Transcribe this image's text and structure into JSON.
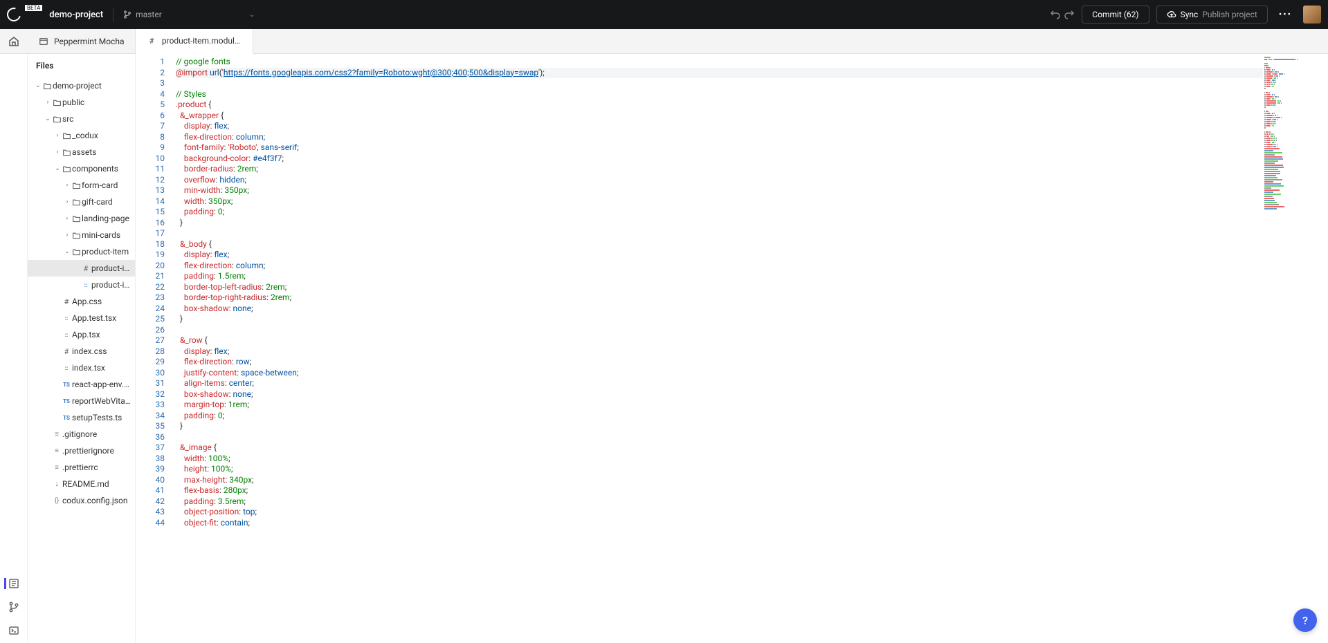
{
  "top": {
    "beta": "BETA",
    "project": "demo-project",
    "branch": "master",
    "commit": "Commit (62)",
    "sync": "Sync",
    "publish": "Publish project"
  },
  "tabs": [
    {
      "icon": "board",
      "label": "Peppermint Mocha",
      "active": false
    },
    {
      "icon": "hash",
      "label": "product-item.module...",
      "active": true
    }
  ],
  "sidebar": {
    "heading": "Files",
    "tree": [
      {
        "d": 0,
        "c": "open",
        "i": "folder",
        "t": "demo-project"
      },
      {
        "d": 1,
        "c": "closed",
        "i": "folder",
        "t": "public"
      },
      {
        "d": 1,
        "c": "open",
        "i": "folder",
        "t": "src"
      },
      {
        "d": 2,
        "c": "closed",
        "i": "folder",
        "t": "_codux"
      },
      {
        "d": 2,
        "c": "closed",
        "i": "folder",
        "t": "assets"
      },
      {
        "d": 2,
        "c": "open",
        "i": "folder",
        "t": "components"
      },
      {
        "d": 3,
        "c": "closed",
        "i": "folder",
        "t": "form-card"
      },
      {
        "d": 3,
        "c": "closed",
        "i": "folder",
        "t": "gift-card"
      },
      {
        "d": 3,
        "c": "closed",
        "i": "folder",
        "t": "landing-page"
      },
      {
        "d": 3,
        "c": "closed",
        "i": "folder",
        "t": "mini-cards"
      },
      {
        "d": 3,
        "c": "open",
        "i": "folder",
        "t": "product-item"
      },
      {
        "d": 4,
        "c": "none",
        "i": "hash",
        "t": "product-ite...",
        "sel": true
      },
      {
        "d": 4,
        "c": "none",
        "i": "tsx",
        "t": "product-ite..."
      },
      {
        "d": 2,
        "c": "none",
        "i": "hash",
        "t": "App.css"
      },
      {
        "d": 2,
        "c": "none",
        "i": "tsx",
        "t": "App.test.tsx"
      },
      {
        "d": 2,
        "c": "none",
        "i": "tsx",
        "t": "App.tsx"
      },
      {
        "d": 2,
        "c": "none",
        "i": "hash",
        "t": "index.css"
      },
      {
        "d": 2,
        "c": "none",
        "i": "tsx",
        "t": "index.tsx"
      },
      {
        "d": 2,
        "c": "none",
        "i": "ts",
        "t": "react-app-env.d.ts"
      },
      {
        "d": 2,
        "c": "none",
        "i": "ts",
        "t": "reportWebVital..."
      },
      {
        "d": 2,
        "c": "none",
        "i": "ts",
        "t": "setupTests.ts"
      },
      {
        "d": 1,
        "c": "none",
        "i": "file",
        "t": ".gitignore"
      },
      {
        "d": 1,
        "c": "none",
        "i": "file",
        "t": ".prettierignore"
      },
      {
        "d": 1,
        "c": "none",
        "i": "file",
        "t": ".prettierrc"
      },
      {
        "d": 1,
        "c": "none",
        "i": "md",
        "t": "README.md"
      },
      {
        "d": 1,
        "c": "none",
        "i": "json",
        "t": "codux.config.json"
      }
    ]
  },
  "editor": {
    "highlight_line": 2,
    "lines": [
      [
        [
          "cm",
          "// google fonts"
        ]
      ],
      [
        [
          "kw",
          "@import"
        ],
        [
          "punc",
          " "
        ],
        [
          "fn",
          "url"
        ],
        [
          "punc",
          "("
        ],
        [
          "str",
          "'"
        ],
        [
          "url",
          "https://fonts.googleapis.com/css2?family=Roboto:wght@300;400;500&display=swap"
        ],
        [
          "str",
          "'"
        ],
        [
          "punc",
          ");"
        ]
      ],
      [],
      [
        [
          "cm",
          "// Styles"
        ]
      ],
      [
        [
          "sel",
          ".product"
        ],
        [
          "punc",
          " {"
        ]
      ],
      [
        [
          "punc",
          "  "
        ],
        [
          "sel",
          "&_wrapper"
        ],
        [
          "punc",
          " {"
        ]
      ],
      [
        [
          "punc",
          "    "
        ],
        [
          "prop",
          "display"
        ],
        [
          "punc",
          ": "
        ],
        [
          "val",
          "flex"
        ],
        [
          "punc",
          ";"
        ]
      ],
      [
        [
          "punc",
          "    "
        ],
        [
          "prop",
          "flex-direction"
        ],
        [
          "punc",
          ": "
        ],
        [
          "val",
          "column"
        ],
        [
          "punc",
          ";"
        ]
      ],
      [
        [
          "punc",
          "    "
        ],
        [
          "prop",
          "font-family"
        ],
        [
          "punc",
          ": "
        ],
        [
          "str",
          "'Roboto'"
        ],
        [
          "punc",
          ", "
        ],
        [
          "val",
          "sans-serif"
        ],
        [
          "punc",
          ";"
        ]
      ],
      [
        [
          "punc",
          "    "
        ],
        [
          "prop",
          "background-color"
        ],
        [
          "punc",
          ": "
        ],
        [
          "val",
          "#e4f3f7"
        ],
        [
          "punc",
          ";"
        ]
      ],
      [
        [
          "punc",
          "    "
        ],
        [
          "prop",
          "border-radius"
        ],
        [
          "punc",
          ": "
        ],
        [
          "num",
          "2rem"
        ],
        [
          "punc",
          ";"
        ]
      ],
      [
        [
          "punc",
          "    "
        ],
        [
          "prop",
          "overflow"
        ],
        [
          "punc",
          ": "
        ],
        [
          "val",
          "hidden"
        ],
        [
          "punc",
          ";"
        ]
      ],
      [
        [
          "punc",
          "    "
        ],
        [
          "prop",
          "min-width"
        ],
        [
          "punc",
          ": "
        ],
        [
          "num",
          "350px"
        ],
        [
          "punc",
          ";"
        ]
      ],
      [
        [
          "punc",
          "    "
        ],
        [
          "prop",
          "width"
        ],
        [
          "punc",
          ": "
        ],
        [
          "num",
          "350px"
        ],
        [
          "punc",
          ";"
        ]
      ],
      [
        [
          "punc",
          "    "
        ],
        [
          "prop",
          "padding"
        ],
        [
          "punc",
          ": "
        ],
        [
          "num",
          "0"
        ],
        [
          "punc",
          ";"
        ]
      ],
      [
        [
          "punc",
          "  }"
        ]
      ],
      [],
      [
        [
          "punc",
          "  "
        ],
        [
          "sel",
          "&_body"
        ],
        [
          "punc",
          " {"
        ]
      ],
      [
        [
          "punc",
          "    "
        ],
        [
          "prop",
          "display"
        ],
        [
          "punc",
          ": "
        ],
        [
          "val",
          "flex"
        ],
        [
          "punc",
          ";"
        ]
      ],
      [
        [
          "punc",
          "    "
        ],
        [
          "prop",
          "flex-direction"
        ],
        [
          "punc",
          ": "
        ],
        [
          "val",
          "column"
        ],
        [
          "punc",
          ";"
        ]
      ],
      [
        [
          "punc",
          "    "
        ],
        [
          "prop",
          "padding"
        ],
        [
          "punc",
          ": "
        ],
        [
          "num",
          "1.5rem"
        ],
        [
          "punc",
          ";"
        ]
      ],
      [
        [
          "punc",
          "    "
        ],
        [
          "prop",
          "border-top-left-radius"
        ],
        [
          "punc",
          ": "
        ],
        [
          "num",
          "2rem"
        ],
        [
          "punc",
          ";"
        ]
      ],
      [
        [
          "punc",
          "    "
        ],
        [
          "prop",
          "border-top-right-radius"
        ],
        [
          "punc",
          ": "
        ],
        [
          "num",
          "2rem"
        ],
        [
          "punc",
          ";"
        ]
      ],
      [
        [
          "punc",
          "    "
        ],
        [
          "prop",
          "box-shadow"
        ],
        [
          "punc",
          ": "
        ],
        [
          "val",
          "none"
        ],
        [
          "punc",
          ";"
        ]
      ],
      [
        [
          "punc",
          "  }"
        ]
      ],
      [],
      [
        [
          "punc",
          "  "
        ],
        [
          "sel",
          "&_row"
        ],
        [
          "punc",
          " {"
        ]
      ],
      [
        [
          "punc",
          "    "
        ],
        [
          "prop",
          "display"
        ],
        [
          "punc",
          ": "
        ],
        [
          "val",
          "flex"
        ],
        [
          "punc",
          ";"
        ]
      ],
      [
        [
          "punc",
          "    "
        ],
        [
          "prop",
          "flex-direction"
        ],
        [
          "punc",
          ": "
        ],
        [
          "val",
          "row"
        ],
        [
          "punc",
          ";"
        ]
      ],
      [
        [
          "punc",
          "    "
        ],
        [
          "prop",
          "justify-content"
        ],
        [
          "punc",
          ": "
        ],
        [
          "val",
          "space-between"
        ],
        [
          "punc",
          ";"
        ]
      ],
      [
        [
          "punc",
          "    "
        ],
        [
          "prop",
          "align-items"
        ],
        [
          "punc",
          ": "
        ],
        [
          "val",
          "center"
        ],
        [
          "punc",
          ";"
        ]
      ],
      [
        [
          "punc",
          "    "
        ],
        [
          "prop",
          "box-shadow"
        ],
        [
          "punc",
          ": "
        ],
        [
          "val",
          "none"
        ],
        [
          "punc",
          ";"
        ]
      ],
      [
        [
          "punc",
          "    "
        ],
        [
          "prop",
          "margin-top"
        ],
        [
          "punc",
          ": "
        ],
        [
          "num",
          "1rem"
        ],
        [
          "punc",
          ";"
        ]
      ],
      [
        [
          "punc",
          "    "
        ],
        [
          "prop",
          "padding"
        ],
        [
          "punc",
          ": "
        ],
        [
          "num",
          "0"
        ],
        [
          "punc",
          ";"
        ]
      ],
      [
        [
          "punc",
          "  }"
        ]
      ],
      [],
      [
        [
          "punc",
          "  "
        ],
        [
          "sel",
          "&_image"
        ],
        [
          "punc",
          " {"
        ]
      ],
      [
        [
          "punc",
          "    "
        ],
        [
          "prop",
          "width"
        ],
        [
          "punc",
          ": "
        ],
        [
          "num",
          "100%"
        ],
        [
          "punc",
          ";"
        ]
      ],
      [
        [
          "punc",
          "    "
        ],
        [
          "prop",
          "height"
        ],
        [
          "punc",
          ": "
        ],
        [
          "num",
          "100%"
        ],
        [
          "punc",
          ";"
        ]
      ],
      [
        [
          "punc",
          "    "
        ],
        [
          "prop",
          "max-height"
        ],
        [
          "punc",
          ": "
        ],
        [
          "num",
          "340px"
        ],
        [
          "punc",
          ";"
        ]
      ],
      [
        [
          "punc",
          "    "
        ],
        [
          "prop",
          "flex-basis"
        ],
        [
          "punc",
          ": "
        ],
        [
          "num",
          "280px"
        ],
        [
          "punc",
          ";"
        ]
      ],
      [
        [
          "punc",
          "    "
        ],
        [
          "prop",
          "padding"
        ],
        [
          "punc",
          ": "
        ],
        [
          "num",
          "3.5rem"
        ],
        [
          "punc",
          ";"
        ]
      ],
      [
        [
          "punc",
          "    "
        ],
        [
          "prop",
          "object-position"
        ],
        [
          "punc",
          ": "
        ],
        [
          "val",
          "top"
        ],
        [
          "punc",
          ";"
        ]
      ],
      [
        [
          "punc",
          "    "
        ],
        [
          "prop",
          "object-fit"
        ],
        [
          "punc",
          ": "
        ],
        [
          "val",
          "contain"
        ],
        [
          "punc",
          ";"
        ]
      ]
    ]
  },
  "help": "?"
}
